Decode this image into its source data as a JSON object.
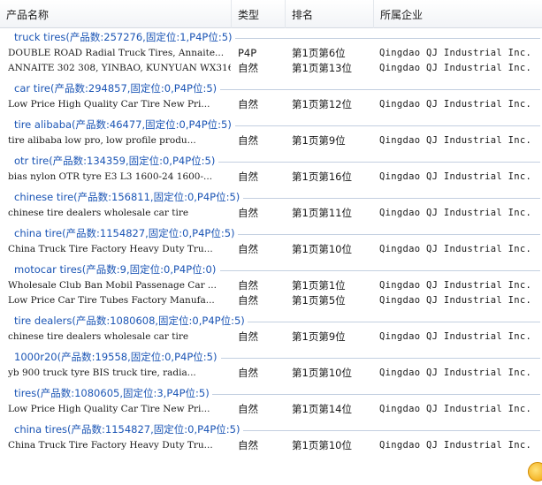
{
  "columns": {
    "name": "产品名称",
    "type": "类型",
    "rank": "排名",
    "company": "所属企业"
  },
  "groups": [
    {
      "keyword": "truck tires",
      "stats": "(产品数:257276,固定位:1,P4P位:5)",
      "items": [
        {
          "name": "DOUBLE ROAD Radial Truck Tires, Annaite...",
          "type": "P4P",
          "rank": "第1页第6位",
          "company": "Qingdao QJ Industrial Inc."
        },
        {
          "name": "ANNAITE 302 308, YINBAO, KUNYUAN WX316 ...",
          "type": "自然",
          "rank": "第1页第13位",
          "company": "Qingdao QJ Industrial Inc."
        }
      ]
    },
    {
      "keyword": "car tire",
      "stats": "(产品数:294857,固定位:0,P4P位:5)",
      "items": [
        {
          "name": "Low Price High Quality Car Tire New Pri...",
          "type": "自然",
          "rank": "第1页第12位",
          "company": "Qingdao QJ Industrial Inc."
        }
      ]
    },
    {
      "keyword": "tire alibaba",
      "stats": "(产品数:46477,固定位:0,P4P位:5)",
      "items": [
        {
          "name": "tire alibaba low pro, low profile produ...",
          "type": "自然",
          "rank": "第1页第9位",
          "company": "Qingdao QJ Industrial Inc."
        }
      ]
    },
    {
      "keyword": "otr tire",
      "stats": "(产品数:134359,固定位:0,P4P位:5)",
      "items": [
        {
          "name": "bias nylon OTR tyre E3 L3 1600-24 1600-...",
          "type": "自然",
          "rank": "第1页第16位",
          "company": "Qingdao QJ Industrial Inc."
        }
      ]
    },
    {
      "keyword": "chinese tire",
      "stats": "(产品数:156811,固定位:0,P4P位:5)",
      "items": [
        {
          "name": "chinese tire dealers wholesale car tire",
          "type": "自然",
          "rank": "第1页第11位",
          "company": "Qingdao QJ Industrial Inc."
        }
      ]
    },
    {
      "keyword": "china tire",
      "stats": "(产品数:1154827,固定位:0,P4P位:5)",
      "items": [
        {
          "name": "China Truck Tire Factory Heavy Duty Tru...",
          "type": "自然",
          "rank": "第1页第10位",
          "company": "Qingdao QJ Industrial Inc."
        }
      ]
    },
    {
      "keyword": "motocar tires",
      "stats": "(产品数:9,固定位:0,P4P位:0)",
      "items": [
        {
          "name": "Wholesale Club Ban Mobil Passenage Car ...",
          "type": "自然",
          "rank": "第1页第1位",
          "company": "Qingdao QJ Industrial Inc."
        },
        {
          "name": "Low Price Car Tire Tubes Factory Manufa...",
          "type": "自然",
          "rank": "第1页第5位",
          "company": "Qingdao QJ Industrial Inc."
        }
      ]
    },
    {
      "keyword": "tire dealers",
      "stats": "(产品数:1080608,固定位:0,P4P位:5)",
      "items": [
        {
          "name": "chinese tire dealers wholesale car tire",
          "type": "自然",
          "rank": "第1页第9位",
          "company": "Qingdao QJ Industrial Inc."
        }
      ]
    },
    {
      "keyword": "1000r20",
      "stats": "(产品数:19558,固定位:0,P4P位:5)",
      "items": [
        {
          "name": "yb 900 truck tyre BIS truck tire, radia...",
          "type": "自然",
          "rank": "第1页第10位",
          "company": "Qingdao QJ Industrial Inc."
        }
      ]
    },
    {
      "keyword": "tires",
      "stats": "(产品数:1080605,固定位:3,P4P位:5)",
      "items": [
        {
          "name": "Low Price High Quality Car Tire New Pri...",
          "type": "自然",
          "rank": "第1页第14位",
          "company": "Qingdao QJ Industrial Inc."
        }
      ]
    },
    {
      "keyword": "china tires",
      "stats": "(产品数:1154827,固定位:0,P4P位:5)",
      "items": [
        {
          "name": "China Truck Tire Factory Heavy Duty Tru...",
          "type": "自然",
          "rank": "第1页第10位",
          "company": "Qingdao QJ Industrial Inc."
        }
      ]
    }
  ]
}
